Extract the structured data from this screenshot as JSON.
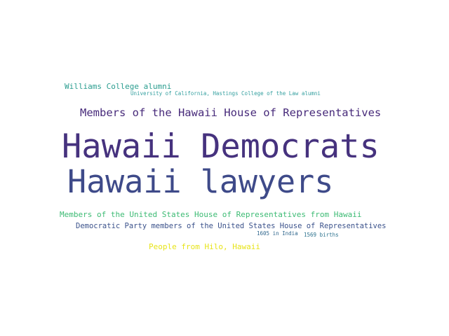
{
  "words": [
    {
      "text": "Williams College alumni",
      "color": "#2a9d8f"
    },
    {
      "text": "University of California, Hastings College of the Law alumni",
      "color": "#35a0a0"
    },
    {
      "text": "Members of the Hawaii House of Representatives",
      "color": "#472a7a"
    },
    {
      "text": "Hawaii Democrats",
      "color": "#46327e"
    },
    {
      "text": "Hawaii lawyers",
      "color": "#3e4a89"
    },
    {
      "text": "Members of the United States House of Representatives from Hawaii",
      "color": "#3dbb74"
    },
    {
      "text": "Democratic Party members of the United States House of Representatives",
      "color": "#3b528b"
    },
    {
      "text": "1605 in India",
      "color": "#31688e"
    },
    {
      "text": "1569 births",
      "color": "#2c728e"
    },
    {
      "text": "People from Hilo, Hawaii",
      "color": "#e7e419"
    }
  ]
}
